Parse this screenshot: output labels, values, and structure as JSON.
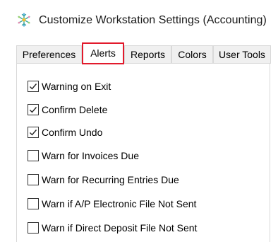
{
  "window": {
    "title": "Customize Workstation Settings (Accounting)",
    "icon": "snowflake-app-icon"
  },
  "tabs": [
    {
      "label": "Preferences",
      "active": false
    },
    {
      "label": "Alerts",
      "active": true
    },
    {
      "label": "Reports",
      "active": false
    },
    {
      "label": "Colors",
      "active": false
    },
    {
      "label": "User Tools",
      "active": false
    }
  ],
  "highlight_color": "#e21a2c",
  "options": [
    {
      "label": "Warning on Exit",
      "checked": true
    },
    {
      "label": "Confirm Delete",
      "checked": true
    },
    {
      "label": "Confirm Undo",
      "checked": true
    },
    {
      "label": "Warn for Invoices Due",
      "checked": false
    },
    {
      "label": "Warn for Recurring Entries Due",
      "checked": false
    },
    {
      "label": "Warn if A/P Electronic File Not Sent",
      "checked": false
    },
    {
      "label": "Warn if Direct Deposit File Not Sent",
      "checked": false
    }
  ]
}
